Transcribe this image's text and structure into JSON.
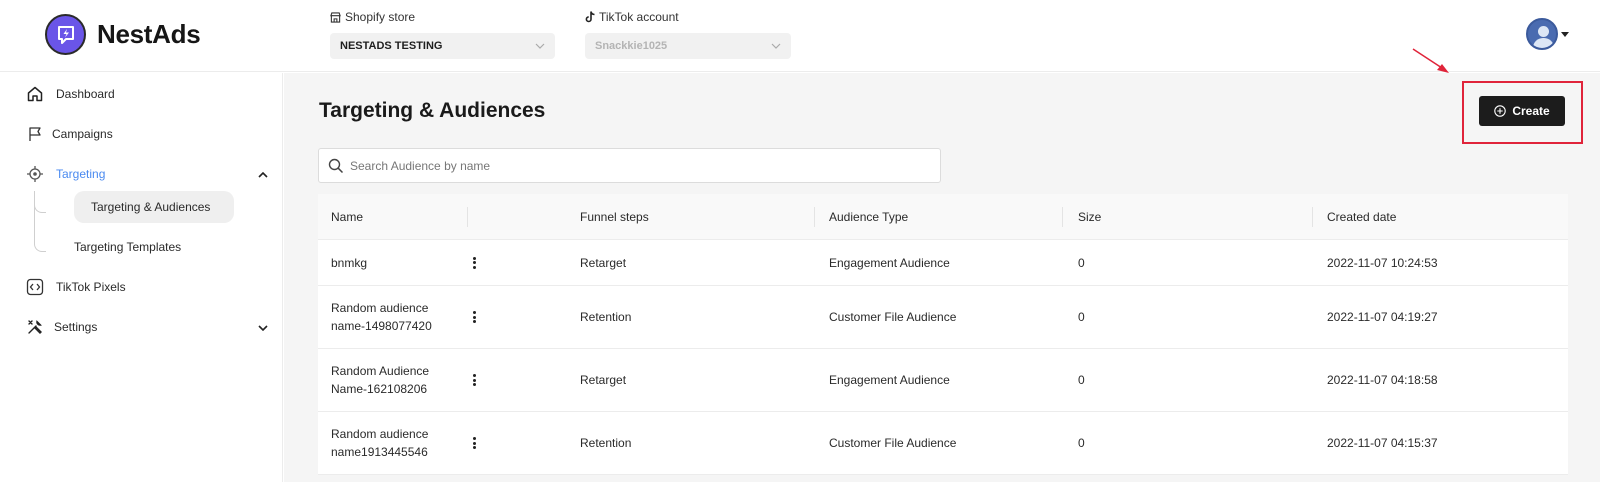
{
  "app": {
    "name": "NestAds"
  },
  "header": {
    "shopify_label": "Shopify store",
    "shopify_value": "NESTADS TESTING",
    "tiktok_label": "TikTok account",
    "tiktok_value": "Snackkie1025"
  },
  "sidebar": {
    "items": [
      {
        "label": "Dashboard",
        "icon": "home-icon"
      },
      {
        "label": "Campaigns",
        "icon": "flag-icon"
      },
      {
        "label": "Targeting",
        "icon": "target-icon"
      },
      {
        "label": "TikTok Pixels",
        "icon": "code-icon"
      },
      {
        "label": "Settings",
        "icon": "tools-icon"
      }
    ],
    "sub_items": [
      {
        "label": "Targeting & Audiences"
      },
      {
        "label": "Targeting Templates"
      }
    ]
  },
  "main": {
    "title": "Targeting & Audiences",
    "create_label": "Create",
    "search_placeholder": "Search Audience by name"
  },
  "table": {
    "columns": [
      "Name",
      "Funnel steps",
      "Audience Type",
      "Size",
      "Created date"
    ],
    "rows": [
      {
        "name": "bnmkg",
        "funnel": "Retarget",
        "type": "Engagement Audience",
        "size": "0",
        "created": "2022-11-07 10:24:53"
      },
      {
        "name": "Random audience name-1498077420",
        "funnel": "Retention",
        "type": "Customer File Audience",
        "size": "0",
        "created": "2022-11-07 04:19:27"
      },
      {
        "name": "Random Audience Name-162108206",
        "funnel": "Retarget",
        "type": "Engagement Audience",
        "size": "0",
        "created": "2022-11-07 04:18:58"
      },
      {
        "name": "Random audience name1913445546",
        "funnel": "Retention",
        "type": "Customer File Audience",
        "size": "0",
        "created": "2022-11-07 04:15:37"
      }
    ]
  },
  "colors": {
    "accent": "#4a8af0",
    "brand": "#6a55e8",
    "highlight": "#e0243a",
    "button": "#1c1c1c"
  }
}
